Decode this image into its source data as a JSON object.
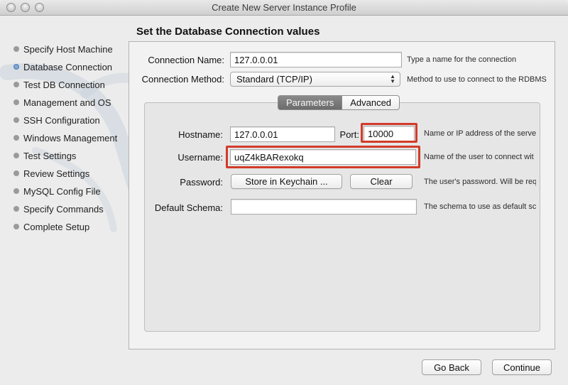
{
  "window": {
    "title": "Create New Server Instance Profile"
  },
  "sidebar": {
    "steps": [
      {
        "label": "Specify Host Machine",
        "active": false
      },
      {
        "label": "Database Connection",
        "active": true
      },
      {
        "label": "Test DB Connection",
        "active": false
      },
      {
        "label": "Management and OS",
        "active": false
      },
      {
        "label": "SSH Configuration",
        "active": false
      },
      {
        "label": "Windows Management",
        "active": false
      },
      {
        "label": "Test Settings",
        "active": false
      },
      {
        "label": "Review Settings",
        "active": false
      },
      {
        "label": "MySQL Config File",
        "active": false
      },
      {
        "label": "Specify Commands",
        "active": false
      },
      {
        "label": "Complete Setup",
        "active": false
      }
    ]
  },
  "page": {
    "title": "Set the Database Connection values"
  },
  "connection": {
    "name_label": "Connection Name:",
    "name_value": "127.0.0.01",
    "name_hint": "Type a name for the connection",
    "method_label": "Connection Method:",
    "method_value": "Standard (TCP/IP)",
    "method_hint": "Method to use to connect to the RDBMS"
  },
  "tabs": {
    "parameters": "Parameters",
    "advanced": "Advanced",
    "selected": "Parameters"
  },
  "params": {
    "hostname_label": "Hostname:",
    "hostname_value": "127.0.0.01",
    "port_label": "Port:",
    "port_value": "10000",
    "hostname_hint": "Name or IP address of the server",
    "username_label": "Username:",
    "username_value": "uqZ4kBARexokq",
    "username_hint": "Name of the user to connect wit",
    "password_label": "Password:",
    "store_keychain": "Store in Keychain ...",
    "clear": "Clear",
    "password_hint": "The user's password. Will be req",
    "schema_label": "Default Schema:",
    "schema_value": "",
    "schema_hint": "The schema to use as default scl"
  },
  "footer": {
    "back": "Go Back",
    "continue": "Continue"
  },
  "colors": {
    "highlight": "#d23b2a",
    "active_dot": "#7ea7d6",
    "selected_tab": "#7a7a7a"
  }
}
